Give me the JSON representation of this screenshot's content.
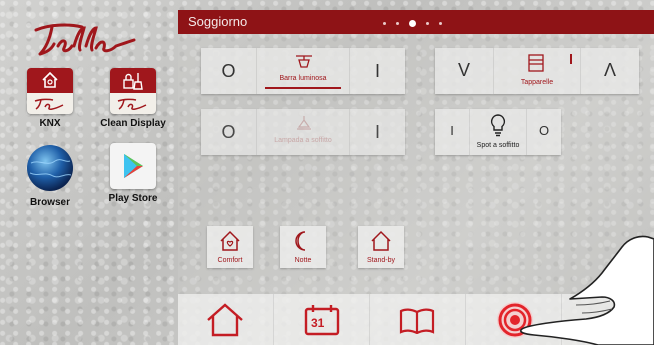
{
  "launcher": {
    "apps": [
      {
        "label": "KNX",
        "icon": "house-icon"
      },
      {
        "label": "Clean Display",
        "icon": "brush-lock-icon"
      },
      {
        "label": "Browser",
        "icon": "globe-icon"
      },
      {
        "label": "Play Store",
        "icon": "play-store-icon"
      }
    ]
  },
  "room": {
    "title": "Soggiorno",
    "page_count": 5,
    "active_page": 3
  },
  "controls": {
    "barra": {
      "label": "Barra luminosa",
      "off": "O",
      "on": "I"
    },
    "lampada": {
      "label": "Lampada a soffitto",
      "off": "O",
      "on": "I"
    },
    "tapparelle": {
      "label": "Tapparelle",
      "down": "V",
      "up": "Λ",
      "stop": "I"
    },
    "spot": {
      "label": "Spot a soffitto",
      "on": "I",
      "off": "O"
    }
  },
  "scenes": [
    {
      "label": "Comfort",
      "icon": "house-heart-icon"
    },
    {
      "label": "Notte",
      "icon": "moon-icon"
    },
    {
      "label": "Stand-by",
      "icon": "house-outline-icon"
    }
  ],
  "nav": {
    "calendar_day": "31"
  },
  "colors": {
    "accent": "#a0171c",
    "titlebar": "#8e1316"
  }
}
